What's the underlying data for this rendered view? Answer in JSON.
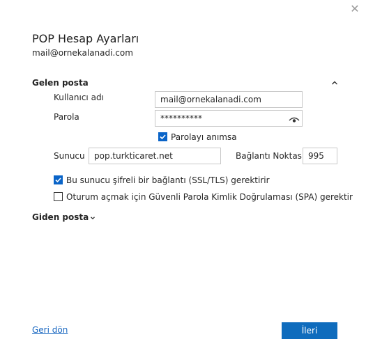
{
  "dialog": {
    "close_icon": "close-icon",
    "title": "POP Hesap Ayarları",
    "email": "mail@ornekalanadi.com"
  },
  "incoming": {
    "header": "Gelen posta",
    "expanded": true,
    "username_label": "Kullanıcı adı",
    "username_value": "mail@ornekalanadi.com",
    "password_label": "Parola",
    "password_value": "**********",
    "remember_password_label": "Parolayı anımsa",
    "remember_password_checked": true,
    "server_label": "Sunucu",
    "server_value": "pop.turkticaret.net",
    "port_label": "Bağlantı Noktası",
    "port_value": "995",
    "ssl_label": "Bu sunucu şifreli bir bağlantı (SSL/TLS) gerektirir",
    "ssl_checked": true,
    "spa_label": "Oturum açmak için Güvenli Parola Kimlik Doğrulaması (SPA) gerektir",
    "spa_checked": false
  },
  "outgoing": {
    "header": "Giden posta",
    "expanded": false
  },
  "footer": {
    "back_label": "Geri dön",
    "next_label": "İleri"
  },
  "colors": {
    "accent": "#0f6cbd",
    "link": "#1565c0"
  }
}
